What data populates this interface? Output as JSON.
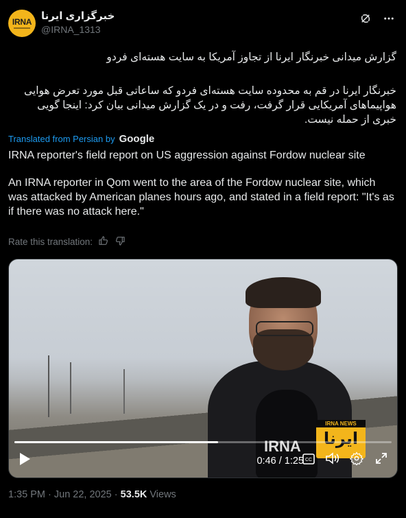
{
  "author": {
    "display_name": "خبرگزاری ایرنا",
    "handle": "@IRNA_1313",
    "avatar_logo": "IRNA"
  },
  "tweet": {
    "persian_title": "گزارش میدانی خبرنگار ایرنا از تجاوز آمریکا به سایت هسته‌ای فردو",
    "persian_body": "خبرنگار ایرنا در قم به محدوده سایت هسته‌ای فردو که ساعاتی قبل مورد تعرض هوایی هواپیماهای آمریکایی قرار گرفت، رفت و در یک گزارش میدانی بیان کرد: اینجا گویی خبری از حمله نیست.",
    "translated_label": "Translated from Persian by",
    "translator_brand": "Google",
    "english_title": "IRNA reporter's field report on US aggression against Fordow nuclear site",
    "english_body": "An IRNA reporter in Qom went to the area of the Fordow nuclear site, which was attacked by American planes hours ago, and stated in a field report: \"It's as if there was no attack here.\"",
    "rate_label": "Rate this translation:"
  },
  "video": {
    "mic_label": "IRNA",
    "watermark_top": "IRNA NEWS",
    "watermark_main": "ایرنا",
    "time_display": "0:46 / 1:25",
    "progress": 0.54
  },
  "meta": {
    "timestamp": "1:35 PM · Jun 22, 2025",
    "separator": "·",
    "views_count": "53.5K",
    "views_label": "Views"
  },
  "icons": {
    "header": [
      "grok-icon",
      "more-icon"
    ],
    "rate": [
      "thumbs-up-icon",
      "thumbs-down-icon"
    ],
    "video": [
      "play-icon",
      "captions-icon",
      "volume-icon",
      "settings-icon",
      "fullscreen-icon"
    ]
  }
}
